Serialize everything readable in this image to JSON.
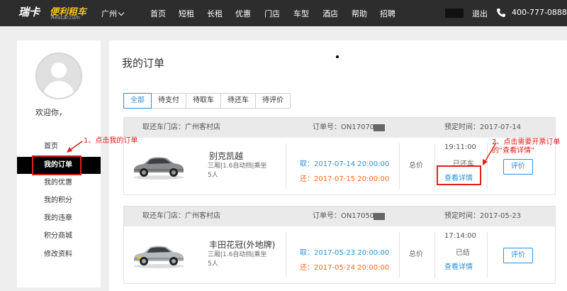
{
  "header": {
    "logo_main": "瑞卡",
    "logo_sub": "便利租车",
    "logo_domain": "Reocar.com",
    "city": "广州",
    "nav": [
      "首页",
      "短租",
      "长租",
      "优惠",
      "门店",
      "车型",
      "酒店",
      "帮助",
      "招聘"
    ],
    "logout": "退出",
    "phone": "400-777-0888"
  },
  "sidebar": {
    "welcome": "欢迎你，",
    "items": [
      "首页",
      "我的订单",
      "我的优惠",
      "我的积分",
      "我的违章",
      "积分商城",
      "修改资料"
    ],
    "active_index": 1
  },
  "main": {
    "title": "我的订单",
    "tabs": [
      "全部",
      "待支付",
      "待取车",
      "待还车",
      "待评价"
    ],
    "active_tab": 0
  },
  "orders": [
    {
      "store": "取还车门店：广州客村店",
      "order_no": "订单号：ON1707001",
      "booked": "预定时间：2017-07-14 19:11:00",
      "car_name": "别克凯越",
      "car_spec": "三厢|1.6自动挡|乘坐5人",
      "pickup": "取：2017-07-14 20:00:00",
      "return": "还：2017-07-15 20:00:00",
      "total_label": "总价",
      "status": "已还车",
      "detail": "查看详情",
      "rate": "评价"
    },
    {
      "store": "取还车门店：广州客村店",
      "order_no": "订单号：ON1705002",
      "booked": "预定时间：2017-05-23 17:14:00",
      "car_name": "丰田花冠(外地牌)",
      "car_spec": "三厢|1.6自动挡|乘坐5人",
      "pickup": "取：2017-05-23 20:00:00",
      "return": "还：2017-05-24 20:00:00",
      "total_label": "总价",
      "status": "已结",
      "detail": "查看详情",
      "rate": "评价"
    }
  ],
  "annotations": {
    "step1": "1、点击我的订单",
    "step2": "2、点击需要开票订单的“查看详情”"
  },
  "colors": {
    "accent_blue": "#2a8fd9",
    "return_orange": "#ff6a1c",
    "annotation_red": "#e0201b",
    "nav_bg": "#2d2d2d"
  }
}
